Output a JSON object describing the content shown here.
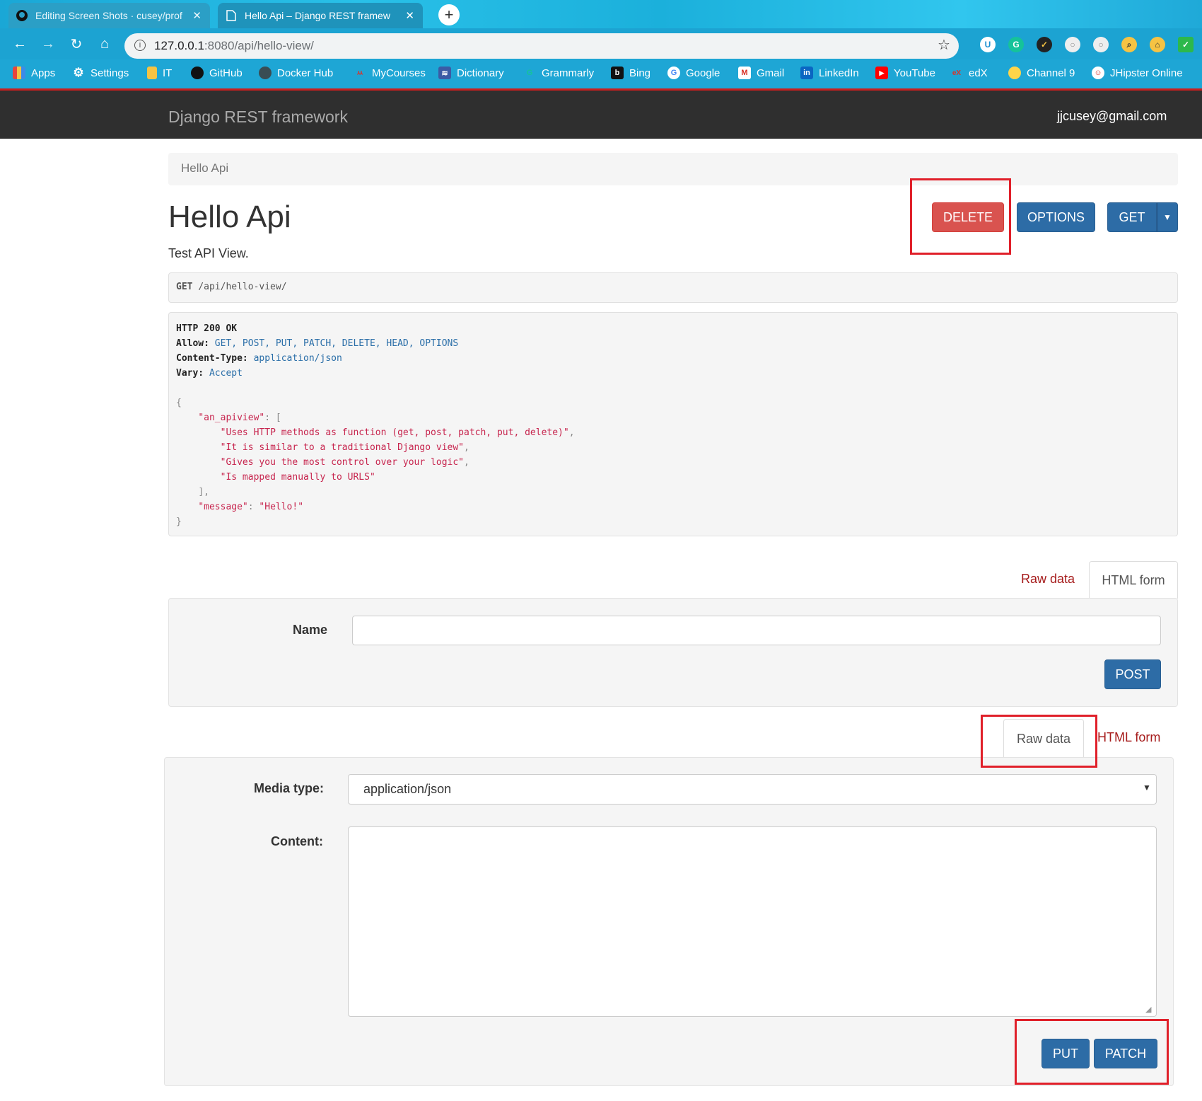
{
  "browser": {
    "tabs": [
      {
        "title": "Editing Screen Shots · cusey/prof",
        "icon": "github-icon"
      },
      {
        "title": "Hello Api – Django REST framew",
        "icon": "page-icon"
      }
    ],
    "url_host": "127.0.0.1",
    "url_rest": ":8080/api/hello-view/",
    "bookmarks": [
      {
        "label": "Apps",
        "icon": "apps-icon",
        "color": "#e8453c"
      },
      {
        "label": "Settings",
        "icon": "gear-icon",
        "color": "#ffffff"
      },
      {
        "label": "IT",
        "icon": "folder-icon",
        "color": "#f6c343"
      },
      {
        "label": "GitHub",
        "icon": "github-icon",
        "color": "#111111"
      },
      {
        "label": "Docker Hub",
        "icon": "docker-icon",
        "color": "#394d54"
      },
      {
        "label": "MyCourses",
        "icon": "mycourses-icon",
        "color": "#d9342b"
      },
      {
        "label": "Dictionary",
        "icon": "dictionary-icon",
        "color": "#3b5ba5"
      },
      {
        "label": "Grammarly",
        "icon": "grammarly-icon",
        "color": "#15c39a"
      },
      {
        "label": "Bing",
        "icon": "bing-icon",
        "color": "#111111"
      },
      {
        "label": "Google",
        "icon": "google-icon",
        "color": "#ffffff"
      },
      {
        "label": "Gmail",
        "icon": "gmail-icon",
        "color": "#d93025"
      },
      {
        "label": "LinkedIn",
        "icon": "linkedin-icon",
        "color": "#0a66c2"
      },
      {
        "label": "YouTube",
        "icon": "youtube-icon",
        "color": "#ff0000"
      },
      {
        "label": "edX",
        "icon": "edx-icon",
        "color": "#02262b"
      },
      {
        "label": "Channel 9",
        "icon": "channel9-icon",
        "color": "#ffd54a"
      },
      {
        "label": "JHipster Online",
        "icon": "jhipster-icon",
        "color": "#ffffff"
      }
    ]
  },
  "navbar": {
    "brand": "Django REST framework",
    "user": "jjcusey@gmail.com"
  },
  "page": {
    "breadcrumb": "Hello Api",
    "title": "Hello Api",
    "description": "Test API View.",
    "buttons": {
      "delete": "DELETE",
      "options": "OPTIONS",
      "get": "GET"
    },
    "request": {
      "method": "GET",
      "path": "/api/hello-view/"
    },
    "response": {
      "status": "HTTP 200 OK",
      "headers": [
        {
          "name": "Allow:",
          "value": "GET, POST, PUT, PATCH, DELETE, HEAD, OPTIONS"
        },
        {
          "name": "Content-Type:",
          "value": "application/json"
        },
        {
          "name": "Vary:",
          "value": "Accept"
        }
      ],
      "json_key_apiview": "\"an_apiview\"",
      "apiview_items": [
        "\"Uses HTTP methods as function (get, post, patch, put, delete)\"",
        "\"It is similar to a traditional Django view\"",
        "\"Gives you the most control over your logic\"",
        "\"Is mapped manually to URLS\""
      ],
      "json_key_message": "\"message\"",
      "json_value_message": "\"Hello!\""
    }
  },
  "form1": {
    "tab_raw": "Raw data",
    "tab_html": "HTML form",
    "name_label": "Name",
    "name_value": "",
    "submit": "POST"
  },
  "form2": {
    "tab_raw": "Raw data",
    "tab_html": "HTML form",
    "media_type_label": "Media type:",
    "media_type_value": "application/json",
    "content_label": "Content:",
    "put": "PUT",
    "patch": "PATCH"
  },
  "colors": {
    "accent_blue": "#2d6ca6",
    "danger_red": "#d9534f",
    "highlight_red": "#e0202a",
    "navbar": "#2f2f2f"
  }
}
